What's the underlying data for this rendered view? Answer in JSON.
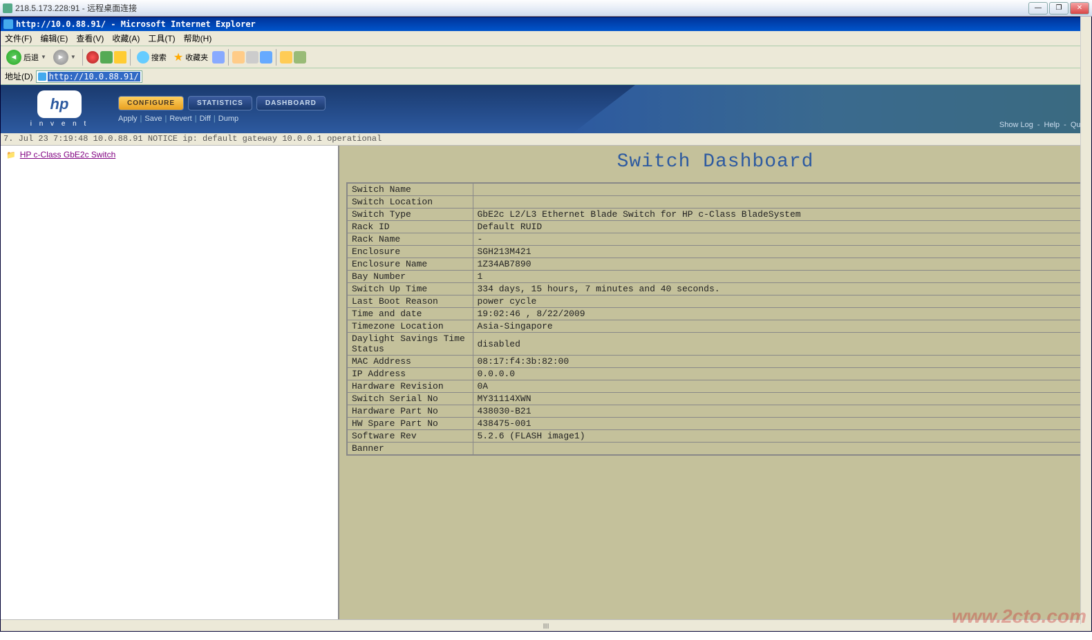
{
  "rdp": {
    "title": "218.5.173.228:91 - 远程桌面连接"
  },
  "ie": {
    "title": "http://10.0.88.91/ - Microsoft Internet Explorer",
    "menu": [
      "文件(F)",
      "编辑(E)",
      "查看(V)",
      "收藏(A)",
      "工具(T)",
      "帮助(H)"
    ],
    "back": "后退",
    "search": "搜索",
    "fav": "收藏夹",
    "addr_label": "地址(D)",
    "addr_value": "http://10.0.88.91/"
  },
  "hp": {
    "invent": "i n v e n t",
    "tabs": {
      "configure": "CONFIGURE",
      "statistics": "STATISTICS",
      "dashboard": "DASHBOARD"
    },
    "actions": {
      "apply": "Apply",
      "save": "Save",
      "revert": "Revert",
      "diff": "Diff",
      "dump": "Dump"
    },
    "right": {
      "showlog": "Show Log",
      "help": "Help",
      "quit": "Quit"
    }
  },
  "log": "7. Jul 23  7:19:48 10.0.88.91 NOTICE  ip: default gateway 10.0.0.1 operational",
  "tree": {
    "root": "HP c-Class GbE2c Switch"
  },
  "dashboard": {
    "title": "Switch Dashboard",
    "rows": [
      {
        "k": "Switch Name",
        "v": ""
      },
      {
        "k": "Switch Location",
        "v": ""
      },
      {
        "k": "Switch Type",
        "v": "GbE2c L2/L3 Ethernet Blade Switch for HP c-Class BladeSystem"
      },
      {
        "k": "Rack ID",
        "v": "Default RUID"
      },
      {
        "k": "Rack Name",
        "v": "-"
      },
      {
        "k": "Enclosure",
        "v": "SGH213M421"
      },
      {
        "k": "Enclosure Name",
        "v": "1Z34AB7890"
      },
      {
        "k": "Bay Number",
        "v": " 1"
      },
      {
        "k": "Switch Up Time",
        "v": "334 days, 15 hours, 7 minutes and 40 seconds."
      },
      {
        "k": "Last Boot Reason",
        "v": "power cycle"
      },
      {
        "k": "Time and date",
        "v": "19:02:46 , 8/22/2009"
      },
      {
        "k": "Timezone Location",
        "v": "Asia-Singapore"
      },
      {
        "k": "Daylight Savings Time Status",
        "v": "disabled"
      },
      {
        "k": "MAC Address",
        "v": "08:17:f4:3b:82:00"
      },
      {
        "k": "IP Address",
        "v": "0.0.0.0"
      },
      {
        "k": "Hardware Revision",
        "v": "0A"
      },
      {
        "k": "Switch Serial No",
        "v": "MY31114XWN"
      },
      {
        "k": "Hardware Part No",
        "v": "438030-B21"
      },
      {
        "k": "HW Spare Part No",
        "v": "438475-001"
      },
      {
        "k": "Software Rev",
        "v": "5.2.6 (FLASH image1)"
      },
      {
        "k": "Banner",
        "v": ""
      }
    ]
  },
  "watermark": "www.2cto.com"
}
